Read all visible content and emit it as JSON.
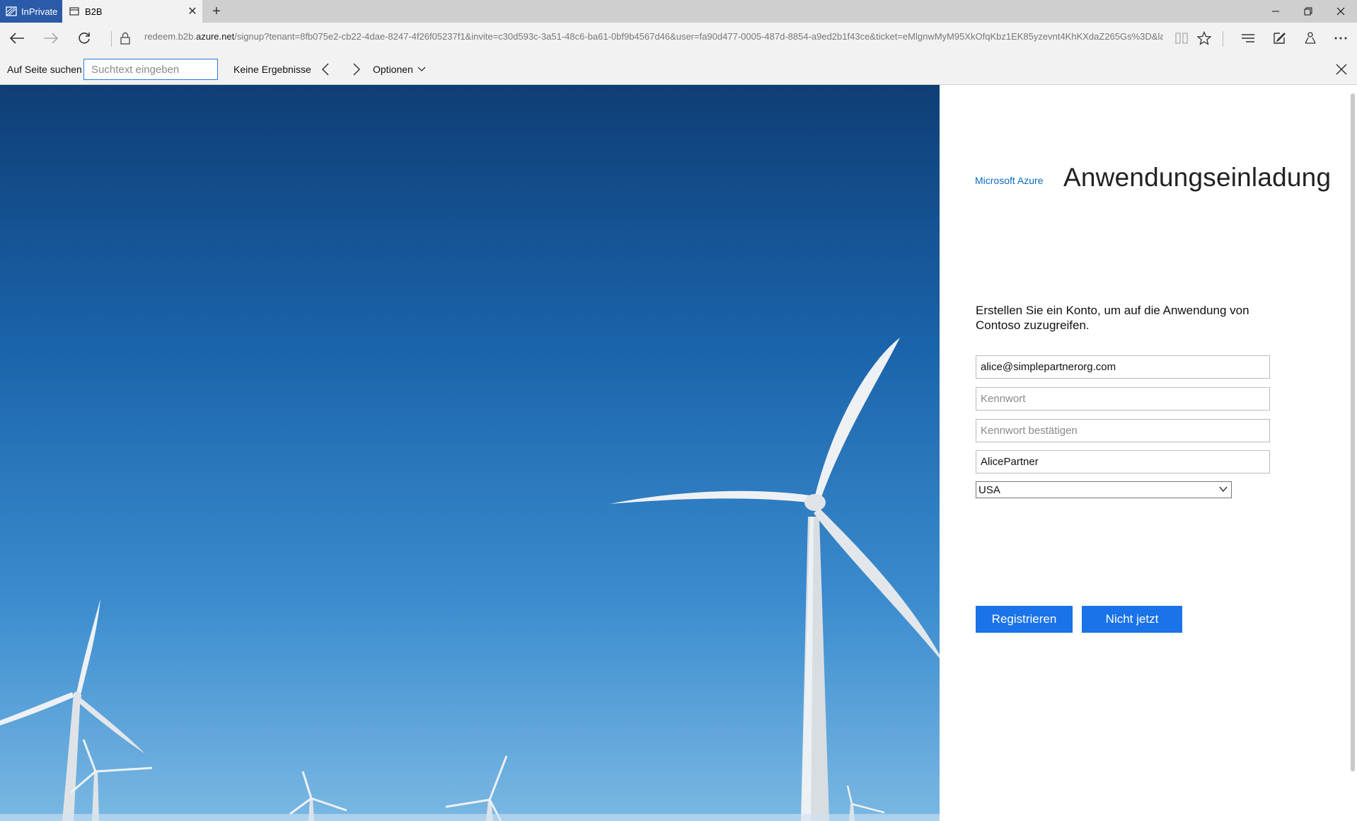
{
  "tabs": {
    "private_label": "InPrivate",
    "active_title": "B2B",
    "close_glyph": "✕",
    "new_tab_glyph": "+"
  },
  "window": {
    "minimize_glyph": "—",
    "maximize_glyph": "❐",
    "close_glyph": "✕"
  },
  "address": {
    "url_prefix": "redeem.b2b.",
    "url_domain": "azure.net",
    "url_rest": "/signup?tenant=8fb075e2-cb22-4dae-8247-4f26f05237f1&invite=c30d593c-3a51-48c6-ba61-0bf9b4567d46&user=fa90d477-0005-487d-8854-a9ed2b1f43ce&ticket=eMlgnwMyM95XkOfqKbz1EK85yzevnt4KhKXdaZ265Gs%3D&la"
  },
  "findbar": {
    "label": "Auf Seite suchen",
    "placeholder": "Suchtext eingeben",
    "result": "Keine Ergebnisse",
    "options": "Optionen"
  },
  "form": {
    "brand": "Microsoft Azure",
    "heading": "Anwendungseinladung",
    "intro": "Erstellen Sie ein Konto, um auf die Anwendung von Contoso zuzugreifen.",
    "email_value": "alice@simplepartnerorg.com",
    "password_placeholder": "Kennwort",
    "confirm_placeholder": "Kennwort bestätigen",
    "name_value": "AlicePartner",
    "country_value": "USA",
    "register_label": "Registrieren",
    "not_now_label": "Nicht jetzt"
  },
  "colors": {
    "accent": "#1a73e8",
    "brand": "#0a6bc2",
    "private_tab": "#2a5aa8"
  }
}
